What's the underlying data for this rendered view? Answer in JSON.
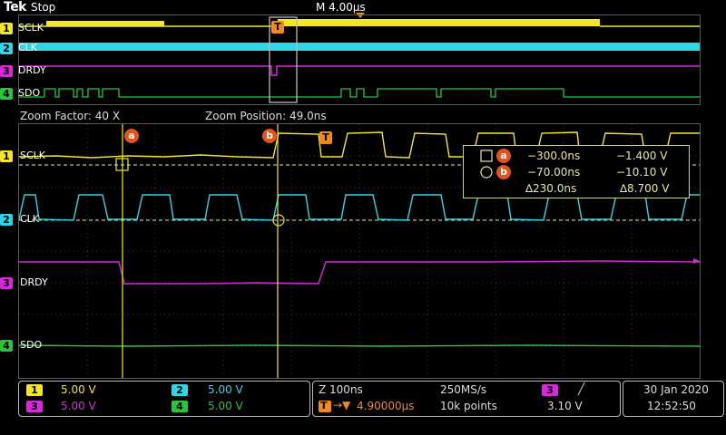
{
  "status": {
    "brand": "Tek",
    "run_state": "Stop",
    "timebase": "M 4.00µs"
  },
  "zoom": {
    "factor": "Zoom Factor: 40 X",
    "position": "Zoom Position: 49.0ns"
  },
  "channels": [
    {
      "num": "1",
      "label": "SCLK",
      "color": "#f2e52a"
    },
    {
      "num": "2",
      "label": "CLK",
      "color": "#2fd6e8"
    },
    {
      "num": "3",
      "label": "DRDY",
      "color": "#d62ad8"
    },
    {
      "num": "4",
      "label": "SDO",
      "color": "#2cc43a"
    }
  ],
  "cursors": {
    "a_label": "a",
    "b_label": "b",
    "trigger_label": "T",
    "a_time": "−300.0ns",
    "a_volt": "−1.400 V",
    "b_time": "−70.00ns",
    "b_volt": "−10.10 V",
    "delta_time": "∆230.0ns",
    "delta_volt": "∆8.700 V"
  },
  "vertical": {
    "ch1_scale": "5.00 V",
    "ch2_scale": "5.00 V",
    "ch3_scale": "5.00 V",
    "ch4_scale": "5.00 V"
  },
  "horizontal": {
    "zoom_scale": "Z 100ns",
    "sample_rate": "250MS/s",
    "trigger_delay": "4.90000µs",
    "record_length": "10k points"
  },
  "trigger": {
    "source": "3",
    "slope": "╱",
    "level": "3.10 V"
  },
  "datetime": {
    "date": "30 Jan  2020",
    "time": "12:52:50"
  }
}
